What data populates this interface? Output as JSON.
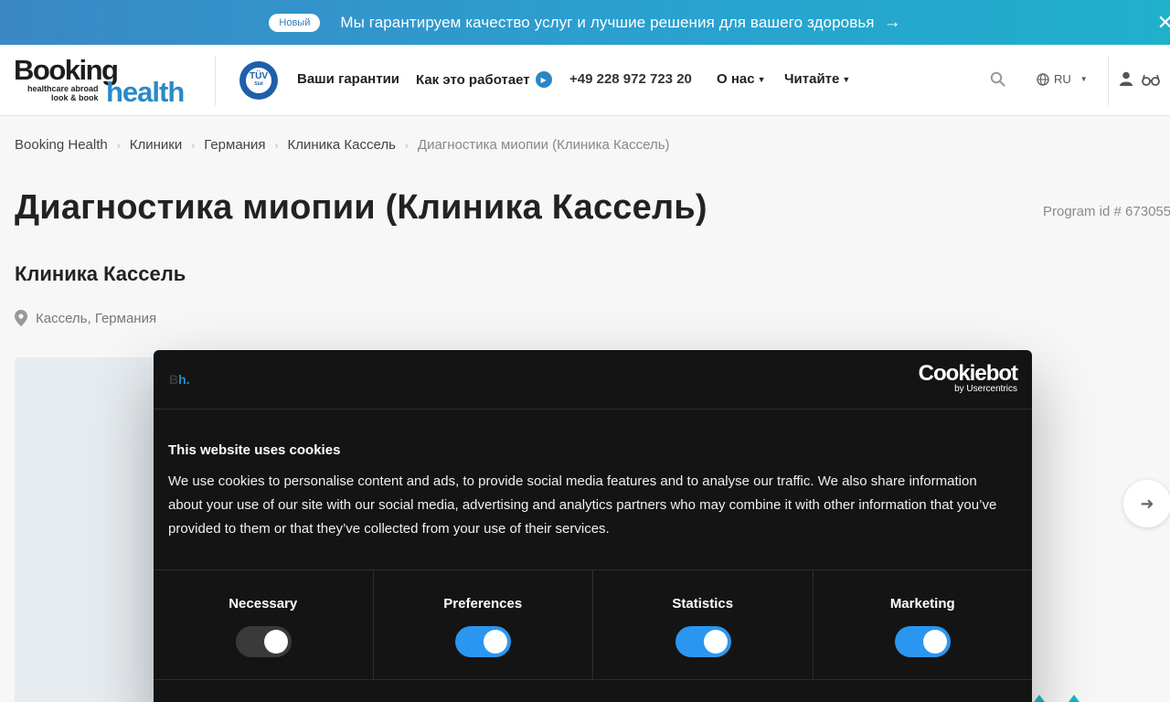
{
  "promo": {
    "badge": "Новый",
    "text": "Мы гарантируем качество услуг и лучшие решения для вашего здоровья",
    "arrow": "→",
    "close": "✕"
  },
  "header": {
    "logo": {
      "booking": "Booking",
      "health": "health",
      "tagline_1": "healthcare abroad",
      "tagline_2": "look & book"
    },
    "tuv": {
      "line1": "TÜV",
      "line2": "Süd"
    },
    "nav": {
      "guarantees": "Ваши гарантии",
      "how_it_works": "Как это работает",
      "phone": "+49 228 972 723 20",
      "about": "О нас",
      "read": "Читайте"
    },
    "language": "RU"
  },
  "breadcrumb": [
    "Booking Health",
    "Клиники",
    "Германия",
    "Клиника Кассель",
    "Диагностика миопии (Клиника Кассель)"
  ],
  "page": {
    "title": "Диагностика миопии (Клиника Кассель)",
    "program_id": "Program id # 673055",
    "clinic": "Клиника Кассель",
    "location": "Кассель, Германия"
  },
  "cookie_dialog": {
    "small_logo_1": "B",
    "small_logo_2": "h.",
    "brand": "Cookiebot",
    "brand_sub": "by Usercentrics",
    "title": "This website uses cookies",
    "body": "We use cookies to personalise content and ads, to provide social media features and to analyse our traffic. We also share information about your use of our site with our social media, advertising and analytics partners who may combine it with other information that you’ve provided to them or that they’ve collected from your use of their services.",
    "categories": [
      {
        "label": "Necessary",
        "enabled": true,
        "locked": true
      },
      {
        "label": "Preferences",
        "enabled": true
      },
      {
        "label": "Statistics",
        "enabled": true
      },
      {
        "label": "Marketing",
        "enabled": true
      }
    ]
  },
  "colors": {
    "brand_blue": "#2a8ac7",
    "toggle_on": "#2a96f0",
    "dialog_bg": "#141414"
  }
}
